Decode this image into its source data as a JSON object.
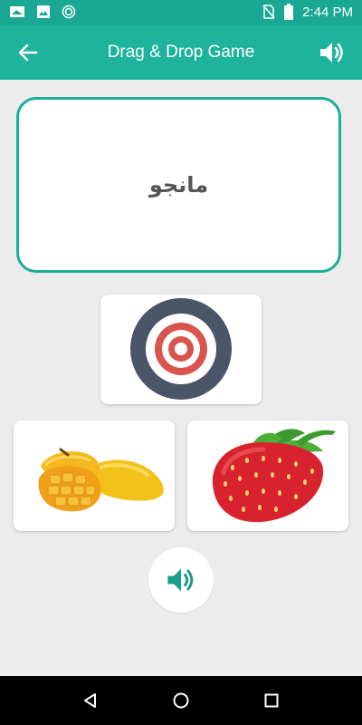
{
  "status_bar": {
    "time": "2:44 PM",
    "icons": [
      "notification-icon",
      "image-icon",
      "sync-icon",
      "no-sim-icon",
      "battery-icon"
    ]
  },
  "app_bar": {
    "title": "Drag & Drop Game",
    "back_icon": "arrow-left-icon",
    "sound_icon": "speaker-icon"
  },
  "game": {
    "word": "مانجو",
    "target_icon": "target-icon",
    "options": [
      {
        "name": "mango",
        "icon": "mango-image"
      },
      {
        "name": "strawberry",
        "icon": "strawberry-image"
      }
    ],
    "play_icon": "speaker-icon"
  },
  "nav_bar": {
    "icons": [
      "back-triangle-icon",
      "home-circle-icon",
      "recents-square-icon"
    ]
  },
  "colors": {
    "primary": "#1db39d",
    "status_bar": "#19a893",
    "accent_border": "#1aae98",
    "background": "#ececec",
    "target_outer": "#4b5568",
    "target_red": "#d9534f"
  }
}
